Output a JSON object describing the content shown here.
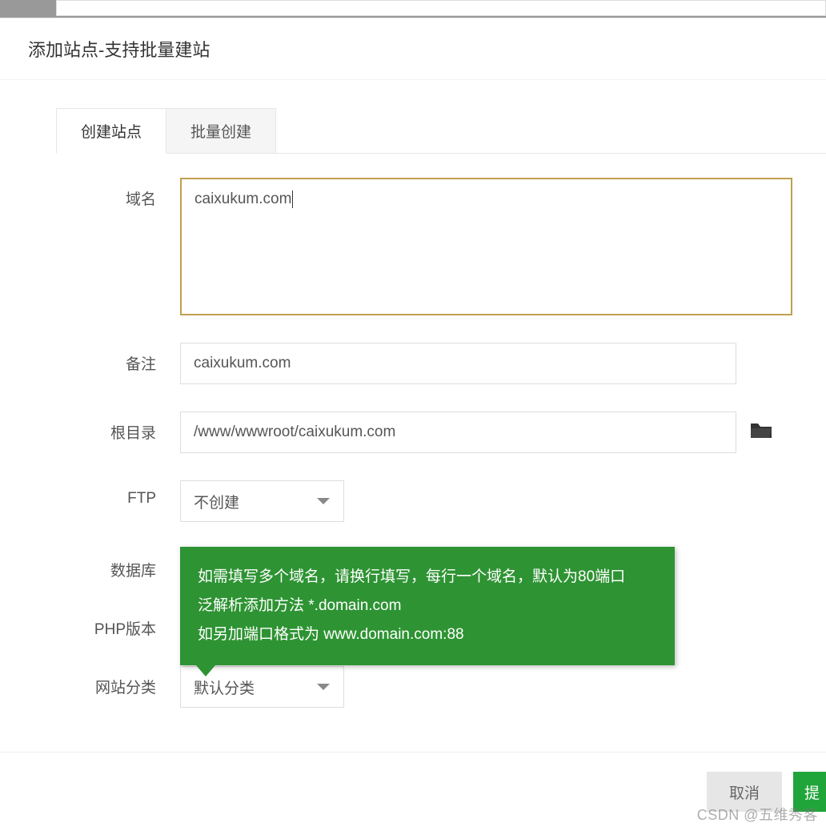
{
  "modal": {
    "title": "添加站点-支持批量建站"
  },
  "tabs": {
    "create": "创建站点",
    "batch": "批量创建"
  },
  "form": {
    "domain": {
      "label": "域名",
      "value": "caixukum.com"
    },
    "remark": {
      "label": "备注",
      "value": "caixukum.com"
    },
    "root": {
      "label": "根目录",
      "value": "/www/wwwroot/caixukum.com"
    },
    "ftp": {
      "label": "FTP",
      "value": "不创建"
    },
    "db": {
      "label": "数据库"
    },
    "php": {
      "label": "PHP版本"
    },
    "category": {
      "label": "网站分类",
      "value": "默认分类"
    }
  },
  "tooltip": {
    "line1": "如需填写多个域名，请换行填写，每行一个域名，默认为80端口",
    "line2": "泛解析添加方法 *.domain.com",
    "line3": "如另加端口格式为 www.domain.com:88"
  },
  "footer": {
    "cancel": "取消",
    "submit": "提"
  },
  "watermark": "CSDN @五维秀客"
}
